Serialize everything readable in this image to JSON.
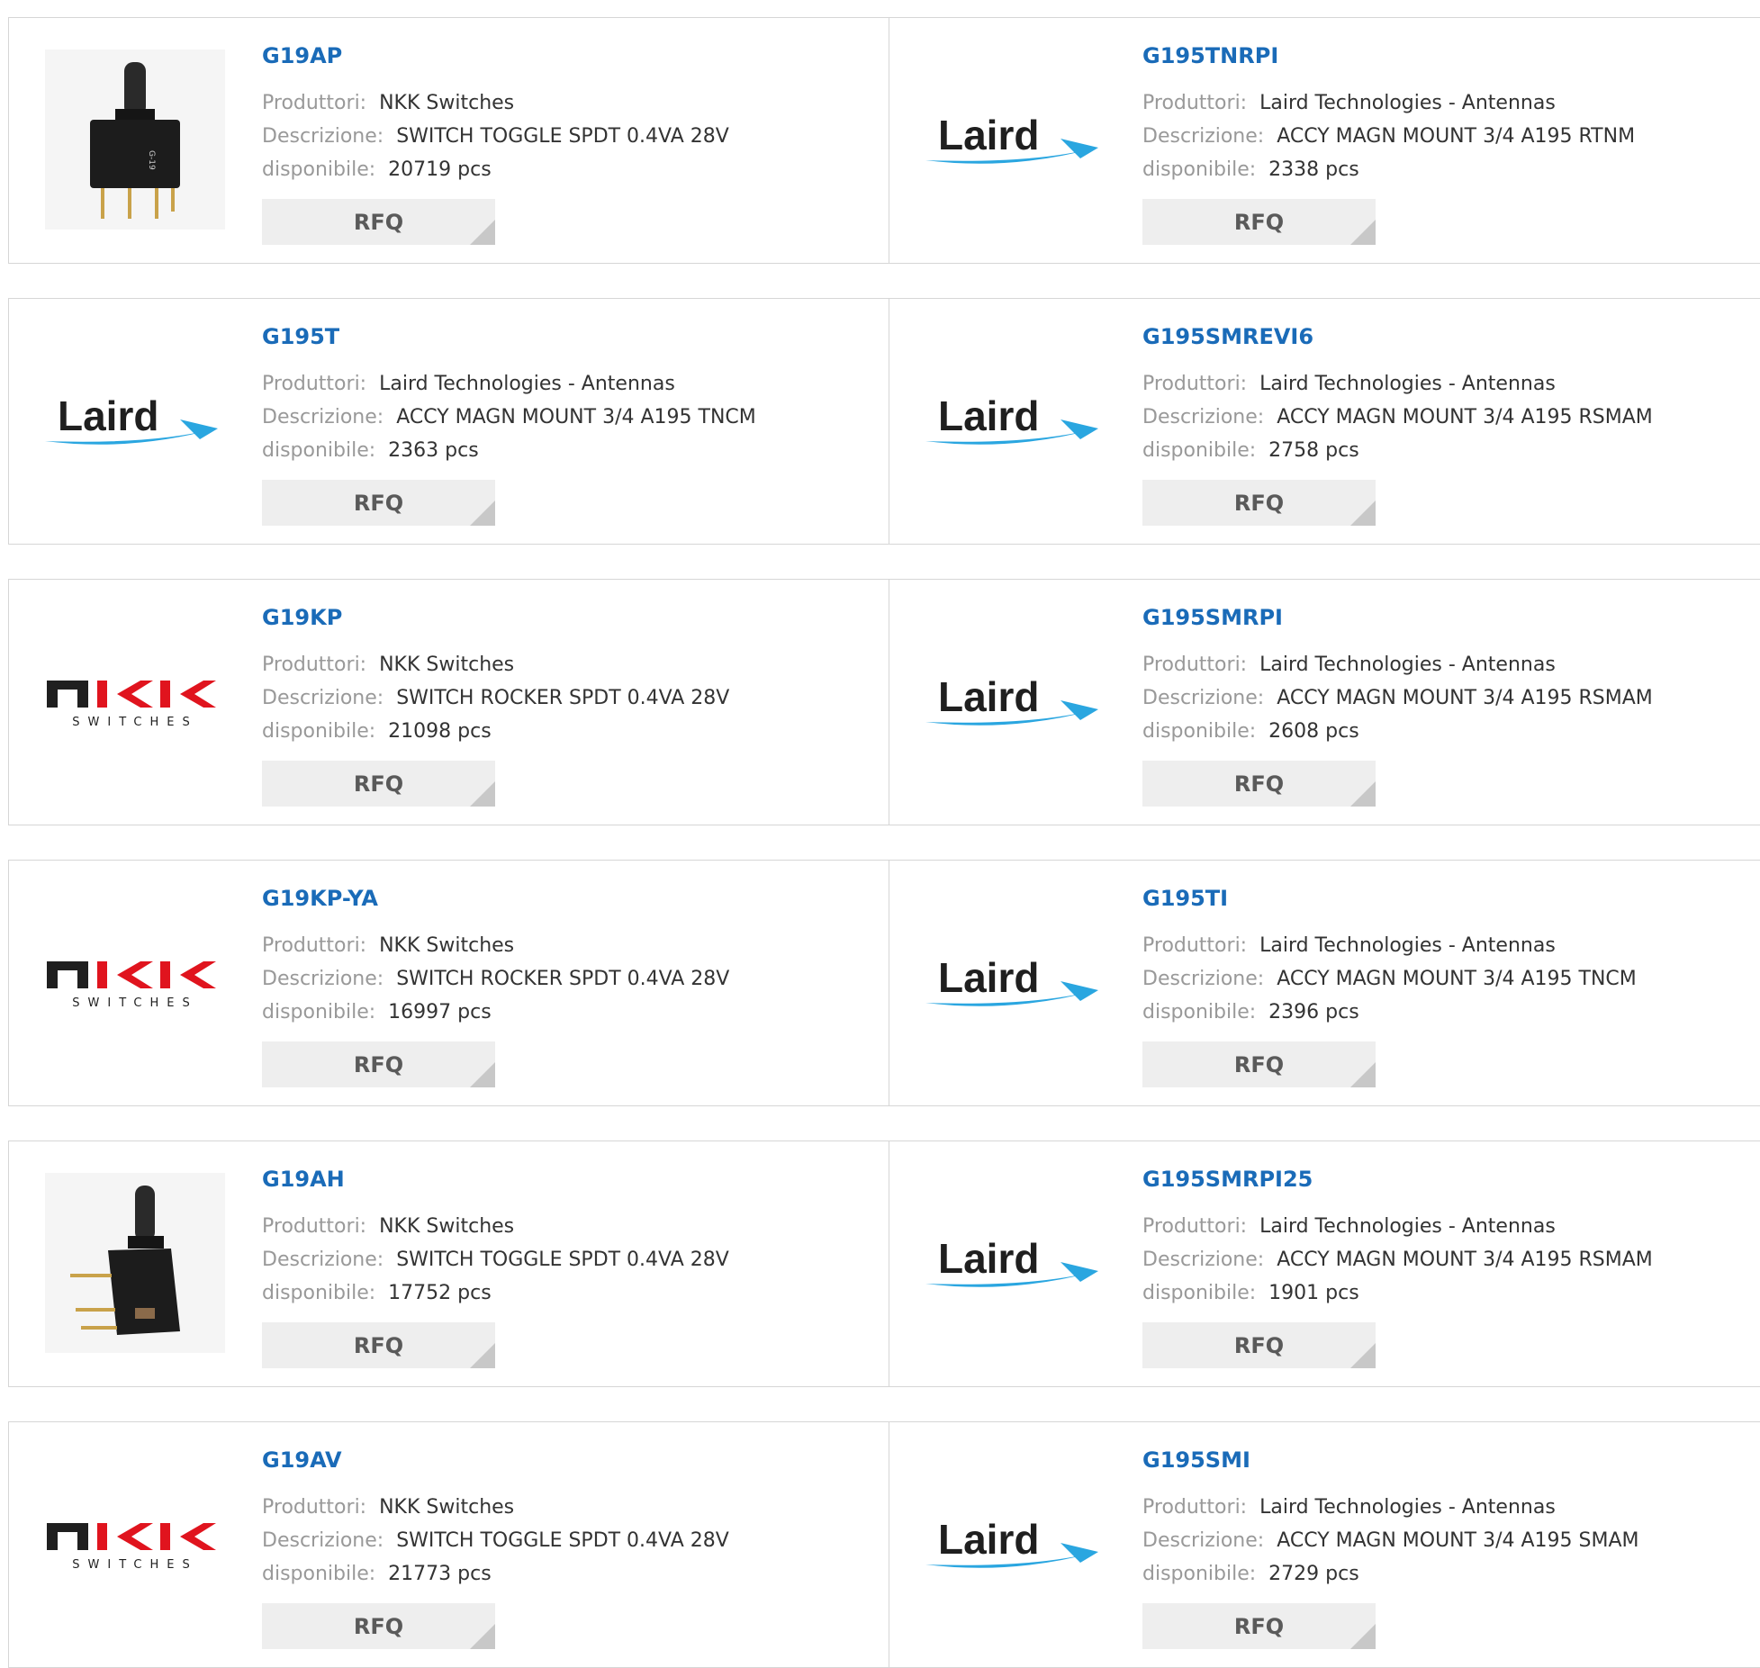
{
  "labels": {
    "manufacturer": "Produttori:",
    "description": "Descrizione:",
    "availability": "disponibile:",
    "rfq": "RFQ"
  },
  "logos": {
    "laird": {
      "text": "Laird",
      "color": "#1f1f1f",
      "swoosh": "#2aa6e0"
    },
    "nkk": {
      "top": "NKK",
      "sub": "SWITCHES",
      "n_color": "#1f1f1f",
      "k_color": "#e0141e"
    }
  },
  "rows": [
    {
      "left": {
        "image": "toggle-switch-photo",
        "part": "G19AP",
        "manufacturer": "NKK Switches",
        "description": "SWITCH TOGGLE SPDT 0.4VA 28V",
        "stock": "20719 pcs"
      },
      "right": {
        "image": "laird-logo",
        "part": "G195TNRPI",
        "manufacturer": "Laird Technologies - Antennas",
        "description": "ACCY MAGN MOUNT 3/4 A195 RTNM",
        "stock": "2338 pcs"
      }
    },
    {
      "left": {
        "image": "laird-logo",
        "part": "G195T",
        "manufacturer": "Laird Technologies - Antennas",
        "description": "ACCY MAGN MOUNT 3/4 A195 TNCM",
        "stock": "2363 pcs"
      },
      "right": {
        "image": "laird-logo",
        "part": "G195SMREVI6",
        "manufacturer": "Laird Technologies - Antennas",
        "description": "ACCY MAGN MOUNT 3/4 A195 RSMAM",
        "stock": "2758 pcs"
      }
    },
    {
      "left": {
        "image": "nkk-logo",
        "part": "G19KP",
        "manufacturer": "NKK Switches",
        "description": "SWITCH ROCKER SPDT 0.4VA 28V",
        "stock": "21098 pcs"
      },
      "right": {
        "image": "laird-logo",
        "part": "G195SMRPI",
        "manufacturer": "Laird Technologies - Antennas",
        "description": "ACCY MAGN MOUNT 3/4 A195 RSMAM",
        "stock": "2608 pcs"
      }
    },
    {
      "left": {
        "image": "nkk-logo",
        "part": "G19KP-YA",
        "manufacturer": "NKK Switches",
        "description": "SWITCH ROCKER SPDT 0.4VA 28V",
        "stock": "16997 pcs"
      },
      "right": {
        "image": "laird-logo",
        "part": "G195TI",
        "manufacturer": "Laird Technologies - Antennas",
        "description": "ACCY MAGN MOUNT 3/4 A195 TNCM",
        "stock": "2396 pcs"
      }
    },
    {
      "left": {
        "image": "toggle-switch-side-photo",
        "part": "G19AH",
        "manufacturer": "NKK Switches",
        "description": "SWITCH TOGGLE SPDT 0.4VA 28V",
        "stock": "17752 pcs"
      },
      "right": {
        "image": "laird-logo",
        "part": "G195SMRPI25",
        "manufacturer": "Laird Technologies - Antennas",
        "description": "ACCY MAGN MOUNT 3/4 A195 RSMAM",
        "stock": "1901 pcs"
      }
    },
    {
      "left": {
        "image": "nkk-logo",
        "part": "G19AV",
        "manufacturer": "NKK Switches",
        "description": "SWITCH TOGGLE SPDT 0.4VA 28V",
        "stock": "21773 pcs"
      },
      "right": {
        "image": "laird-logo",
        "part": "G195SMI",
        "manufacturer": "Laird Technologies - Antennas",
        "description": "ACCY MAGN MOUNT 3/4 A195 SMAM",
        "stock": "2729 pcs"
      }
    }
  ]
}
